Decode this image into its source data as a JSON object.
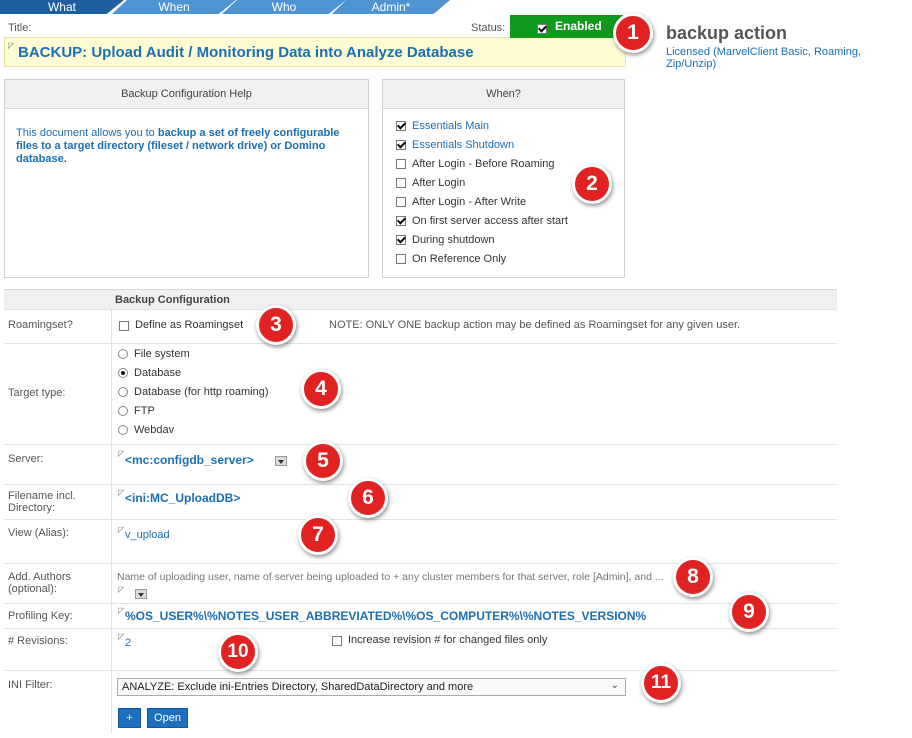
{
  "tabs": [
    "What",
    "When",
    "Who",
    "Admin*"
  ],
  "title_label": "Title:",
  "title_value": "BACKUP: Upload Audit / Monitoring Data into Analyze Database",
  "status_label": "Status:",
  "status_value": "Enabled",
  "form_name": "backup action",
  "license": "Licensed (MarvelClient Basic, Roaming, Zip/Unzip)",
  "help": {
    "heading": "Backup Configuration Help",
    "intro": "This document allows you to ",
    "bold": "backup a set of freely configurable files to a target directory (fileset / network drive) or Domino database."
  },
  "when": {
    "heading": "When?",
    "items": [
      {
        "label": "Essentials Main",
        "checked": true,
        "link": true
      },
      {
        "label": "Essentials Shutdown",
        "checked": true,
        "link": true
      },
      {
        "label": "After Login - Before Roaming",
        "checked": false,
        "link": false
      },
      {
        "label": "After Login",
        "checked": false,
        "link": false
      },
      {
        "label": "After Login - After Write",
        "checked": false,
        "link": false
      },
      {
        "label": "On first server access after start",
        "checked": true,
        "link": false
      },
      {
        "label": "During shutdown",
        "checked": true,
        "link": false
      },
      {
        "label": "On Reference Only",
        "checked": false,
        "link": false
      }
    ]
  },
  "config": {
    "heading": "Backup Configuration",
    "roamingset_label": "Roamingset?",
    "roamingset_option": "Define as Roamingset",
    "roamingset_note": "NOTE: ONLY ONE backup action may be defined as Roamingset for any given user.",
    "target_label": "Target type:",
    "target_options": [
      "File system",
      "Database",
      "Database (for http roaming)",
      "FTP",
      "Webdav"
    ],
    "target_selected": 1,
    "server_label": "Server:",
    "server_value": "<mc:configdb_server>",
    "filename_label": "Filename incl. Directory:",
    "filename_value": "<ini:MC_UploadDB>",
    "view_label": "View (Alias):",
    "view_value": "v_upload",
    "authors_label": "Add. Authors (optional):",
    "authors_hint": "Name of uploading user, name of server being uploaded to + any cluster members for that server, role [Admin], and ...",
    "profiling_label": "Profiling Key:",
    "profiling_value": "%OS_USER%\\%NOTES_USER_ABBREVIATED%\\%OS_COMPUTER%\\%NOTES_VERSION%",
    "revisions_label": "# Revisions:",
    "revisions_value": "2",
    "revisions_option": "Increase revision # for changed files only",
    "ini_label": "INI Filter:",
    "ini_value": "ANALYZE: Exclude ini-Entries Directory, SharedDataDirectory and more",
    "add_button": "+",
    "open_button": "Open"
  },
  "callouts": [
    "1",
    "2",
    "3",
    "4",
    "5",
    "6",
    "7",
    "8",
    "9",
    "10",
    "11"
  ],
  "colors": {
    "tab": "#4e93d2",
    "tab_active": "#1f5f9f",
    "status": "#0f9a1d",
    "link": "#1a6fb5",
    "callout": "#e12222"
  }
}
